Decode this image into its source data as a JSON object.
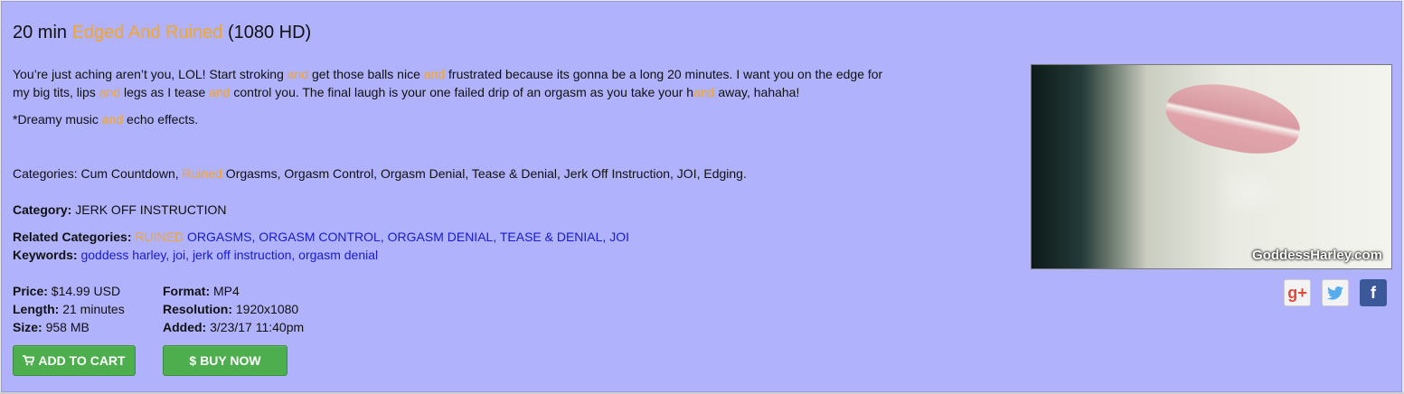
{
  "title": {
    "prefix": "20 min ",
    "highlight": "Edged And Ruined",
    "suffix": " (1080 HD)"
  },
  "description": {
    "line1": [
      {
        "t": "You’re just aching aren’t you, LOL! Start stroking ",
        "hl": false
      },
      {
        "t": "and",
        "hl": true
      },
      {
        "t": " get those balls nice ",
        "hl": false
      },
      {
        "t": "and",
        "hl": true
      },
      {
        "t": " frustrated because its gonna be a long 20 minutes. I want you on the edge for",
        "hl": false
      }
    ],
    "line2": [
      {
        "t": "my big tits, lips ",
        "hl": false
      },
      {
        "t": "and",
        "hl": true
      },
      {
        "t": " legs as I tease ",
        "hl": false
      },
      {
        "t": "and",
        "hl": true
      },
      {
        "t": " control you. The final laugh is your one failed drip of an orgasm as you take your h",
        "hl": false
      },
      {
        "t": "and",
        "hl": true
      },
      {
        "t": " away, hahaha!",
        "hl": false
      }
    ],
    "line3": [
      {
        "t": "*Dreamy music ",
        "hl": false
      },
      {
        "t": "and",
        "hl": true
      },
      {
        "t": " echo effects.",
        "hl": false
      }
    ]
  },
  "categories_line": [
    {
      "t": "Categories: Cum Countdown, ",
      "hl": false
    },
    {
      "t": "Ruined",
      "hl": true
    },
    {
      "t": " Orgasms, Orgasm Control, Orgasm Denial, Tease & Denial, Jerk Off Instruction, JOI, Edging.",
      "hl": false
    }
  ],
  "category": {
    "label": "Category:",
    "value": " JERK OFF INSTRUCTION"
  },
  "related": {
    "label": "Related Categories:",
    "first_hl": "RUINED",
    "rest": "ORGASMS, ORGASM CONTROL, ORGASM DENIAL, TEASE & DENIAL, JOI"
  },
  "keywords": {
    "label": "Keywords:",
    "value": "goddess harley, joi, jerk off instruction, orgasm denial"
  },
  "specs": {
    "price_label": "Price:",
    "price": " $14.99 USD",
    "length_label": "Length:",
    "length": " 21 minutes",
    "size_label": "Size:",
    "size": " 958 MB",
    "format_label": "Format:",
    "format": " MP4",
    "resolution_label": "Resolution:",
    "resolution": " 1920x1080",
    "added_label": "Added:",
    "added": " 3/23/17 11:40pm"
  },
  "buttons": {
    "add_to_cart": "ADD TO CART",
    "buy_now": "BUY NOW",
    "buy_icon": "$"
  },
  "image": {
    "watermark": "GoddessHarley.com"
  },
  "social": {
    "gplus": "g+",
    "facebook": "f"
  },
  "colors": {
    "background": "#b0b2fb",
    "highlight": "#f5a623",
    "link": "#1a1ad0",
    "button": "#4cae4c"
  }
}
